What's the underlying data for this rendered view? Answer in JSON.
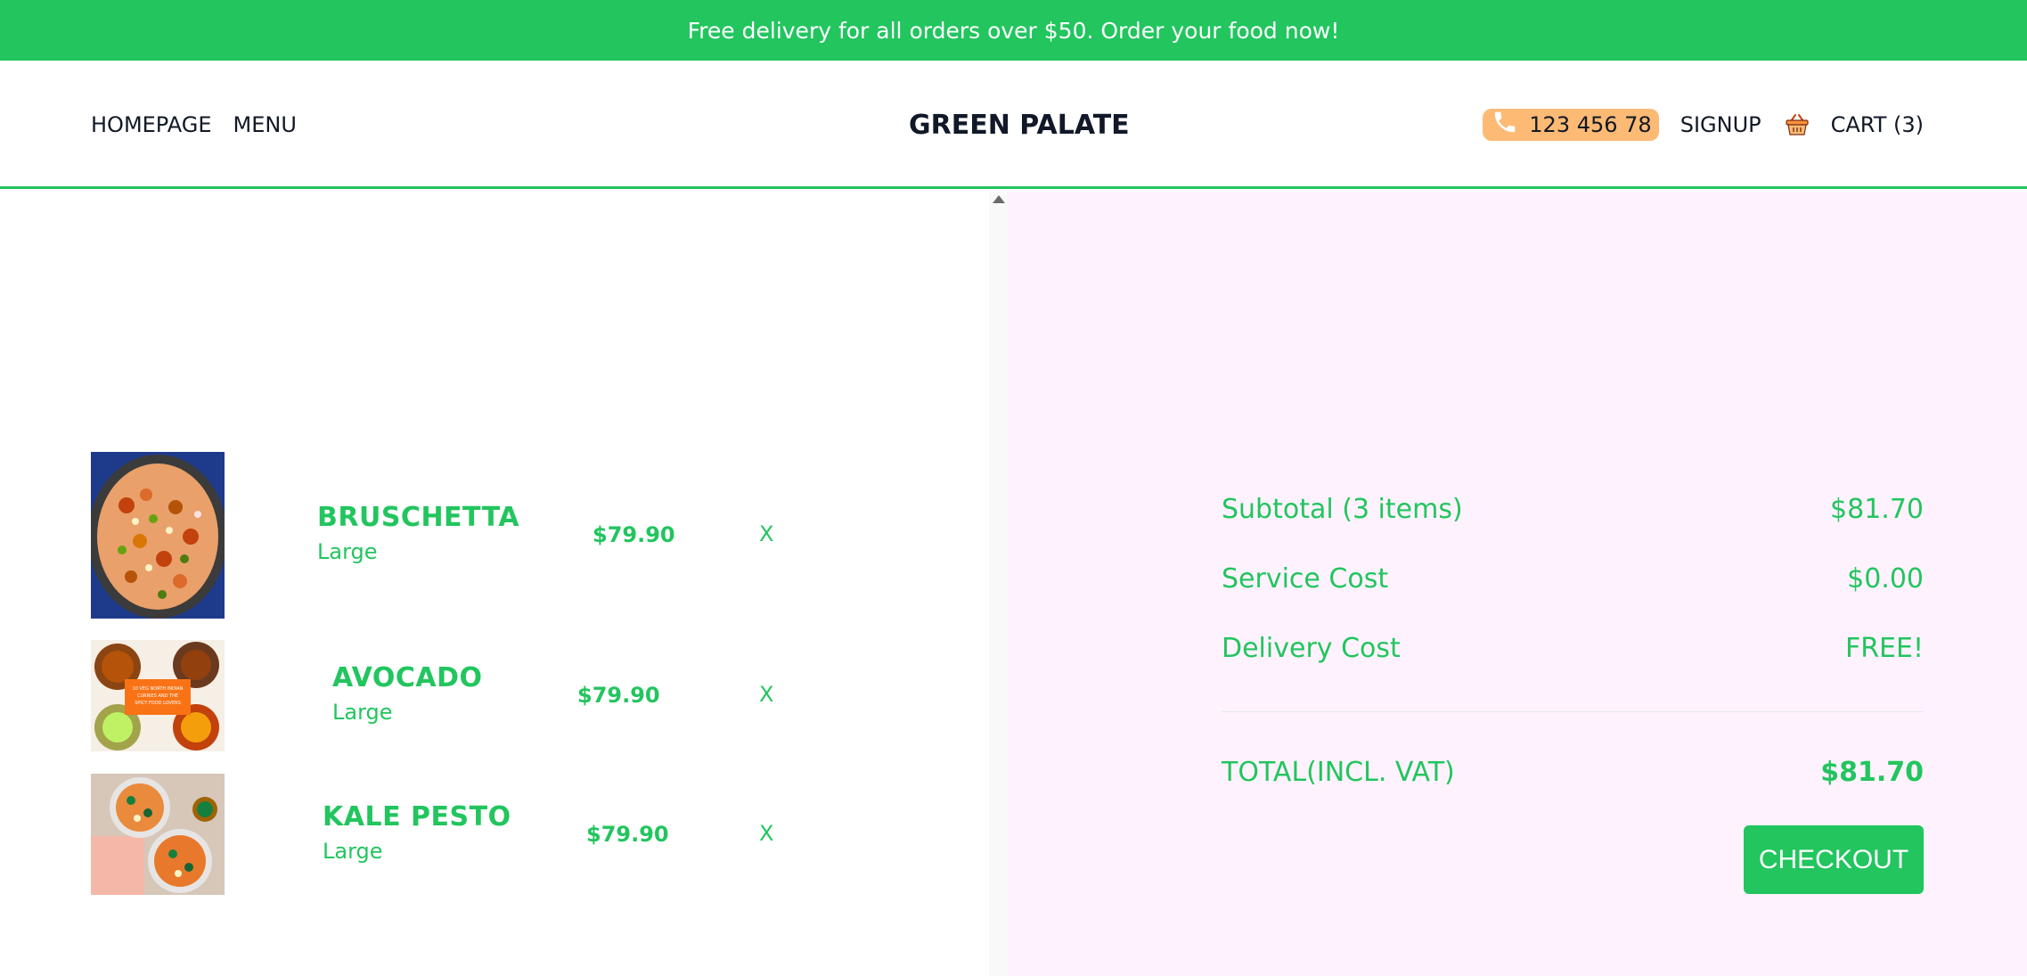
{
  "banner": {
    "text": "Free delivery for all orders over $50. Order your food now!"
  },
  "nav": {
    "left": [
      "HOMEPAGE",
      "MENU"
    ],
    "brand": "GREEN PALATE",
    "phone": "123 456 78",
    "signup": "SIGNUP",
    "cart": "CART (3)"
  },
  "cart_items": [
    {
      "name": "BRUSCHETTA",
      "size": "Large",
      "price": "$79.90",
      "remove": "X"
    },
    {
      "name": "AVOCADO",
      "size": "Large",
      "price": "$79.90",
      "remove": "X"
    },
    {
      "name": "KALE PESTO",
      "size": "Large",
      "price": "$79.90",
      "remove": "X"
    }
  ],
  "avocado_image_caption": "10 VEG NORTH INDIAN CURRIES AND THE SPICY FOOD LOVERS",
  "summary": {
    "subtotal_label": "Subtotal (3 items)",
    "subtotal_value": "$81.70",
    "service_label": "Service Cost",
    "service_value": "$0.00",
    "delivery_label": "Delivery Cost",
    "delivery_value": "FREE!",
    "total_label": "TOTAL(INCL. VAT)",
    "total_value": "$81.70",
    "checkout": "CHECKOUT"
  },
  "colors": {
    "accent": "#22c55e",
    "phone_pill": "#fdba74",
    "summary_bg": "#fdf2fd"
  }
}
